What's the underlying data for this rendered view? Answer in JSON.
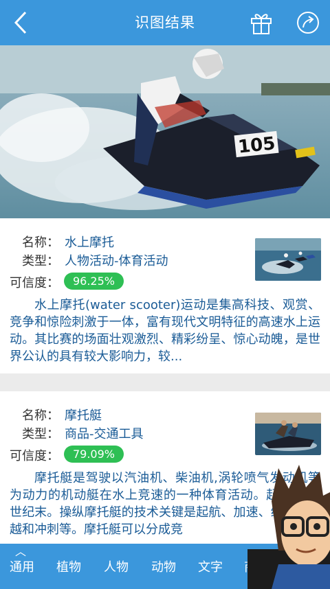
{
  "header": {
    "title": "识图结果",
    "back_icon": "chevron-left-icon",
    "gift_icon": "gift-icon",
    "share_icon": "share-icon"
  },
  "results": [
    {
      "name_label": "名称：",
      "name": "水上摩托",
      "type_label": "类型：",
      "type": "人物活动-体育活动",
      "confidence_label": "可信度：",
      "confidence": "96.25%",
      "description": "水上摩托(water scooter)运动是集高科技、观赏、竞争和惊险刺激于一体，富有现代文明特征的高速水上运动。其比赛的场面壮观激烈、精彩纷呈、惊心动魄，是世界公认的具有较大影响力，较..."
    },
    {
      "name_label": "名称：",
      "name": "摩托艇",
      "type_label": "类型：",
      "type": "商品-交通工具",
      "confidence_label": "可信度：",
      "confidence": "79.09%",
      "description": "摩托艇是驾驶以汽油机、柴油机,涡轮喷气发动机等为动力的机动艇在水上竞速的一种体育活动。起源于19世纪末。操纵摩托艇的技术关键是起航、加速、绕标、超越和冲刺等。摩托艇可以分成竞"
    }
  ],
  "hero": {
    "number": "105"
  },
  "tabs": [
    "通用",
    "植物",
    "人物",
    "动物",
    "文字",
    "商"
  ],
  "colors": {
    "brand": "#3b97dc",
    "badge": "#2ebf54",
    "link_text": "#1a5b96"
  }
}
